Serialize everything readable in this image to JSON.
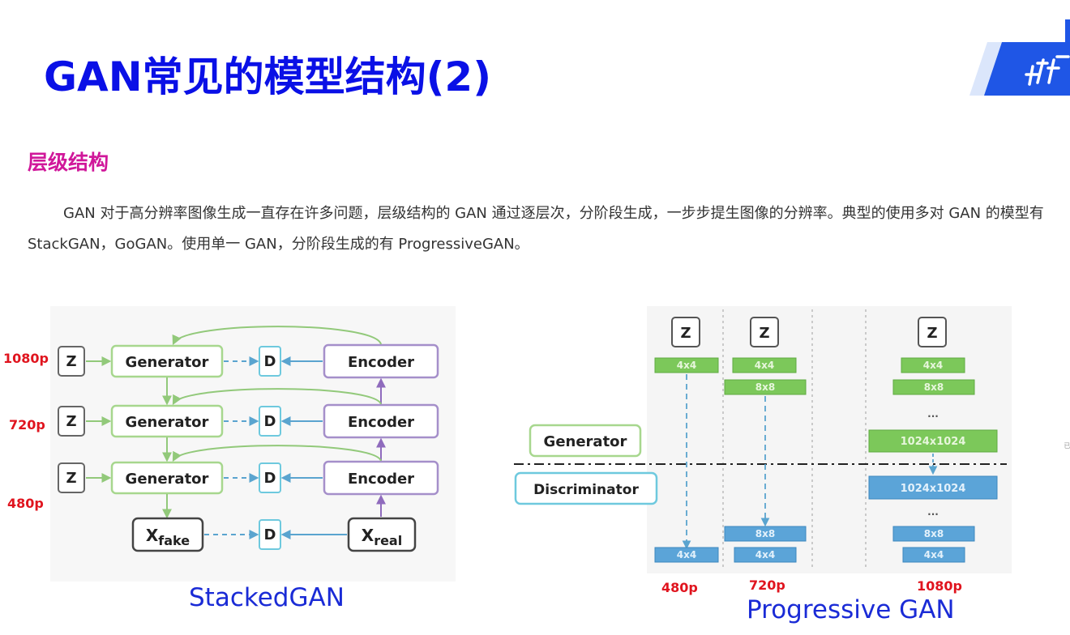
{
  "slide": {
    "title": "GAN常见的模型结构(2)",
    "section": "层级结构",
    "paragraph": "GAN 对于高分辨率图像生成一直存在许多问题，层级结构的 GAN 通过逐层次，分阶段生成，一步步提生图像的分辨率。典型的使用多对 GAN 的模型有StackGAN，GoGAN。使用单一 GAN，分阶段生成的有 ProgressiveGAN。",
    "side_note": "已"
  },
  "stacked": {
    "caption": "StackedGAN",
    "res_labels": [
      "1080p",
      "720p",
      "480p"
    ],
    "rows": [
      {
        "z": "Z",
        "generator": "Generator",
        "d": "D",
        "encoder": "Encoder"
      },
      {
        "z": "Z",
        "generator": "Generator",
        "d": "D",
        "encoder": "Encoder"
      },
      {
        "z": "Z",
        "generator": "Generator",
        "d": "D",
        "encoder": "Encoder"
      }
    ],
    "bottom": {
      "fake_main": "X",
      "fake_sub": "fake",
      "d": "D",
      "real_main": "X",
      "real_sub": "real"
    }
  },
  "progressive": {
    "caption": "Progressive GAN",
    "generator_label": "Generator",
    "discriminator_label": "Discriminator",
    "res_labels": [
      "480p",
      "720p",
      "1080p"
    ],
    "columns": [
      {
        "z": "Z",
        "gen_blocks": [
          "4x4"
        ],
        "dis_blocks": [
          "4x4"
        ]
      },
      {
        "z": "Z",
        "gen_blocks": [
          "4x4",
          "8x8"
        ],
        "dis_blocks": [
          "8x8",
          "4x4"
        ]
      },
      {
        "z": "Z",
        "gen_blocks": [
          "4x4",
          "8x8",
          "...",
          "1024x1024"
        ],
        "dis_blocks": [
          "1024x1024",
          "...",
          "8x8",
          "4x4"
        ]
      }
    ],
    "colors": {
      "gen": "#7cc85a",
      "dis": "#5ba4d8",
      "gen_border": "#a7d78e",
      "dis_border": "#6ec9de"
    }
  }
}
